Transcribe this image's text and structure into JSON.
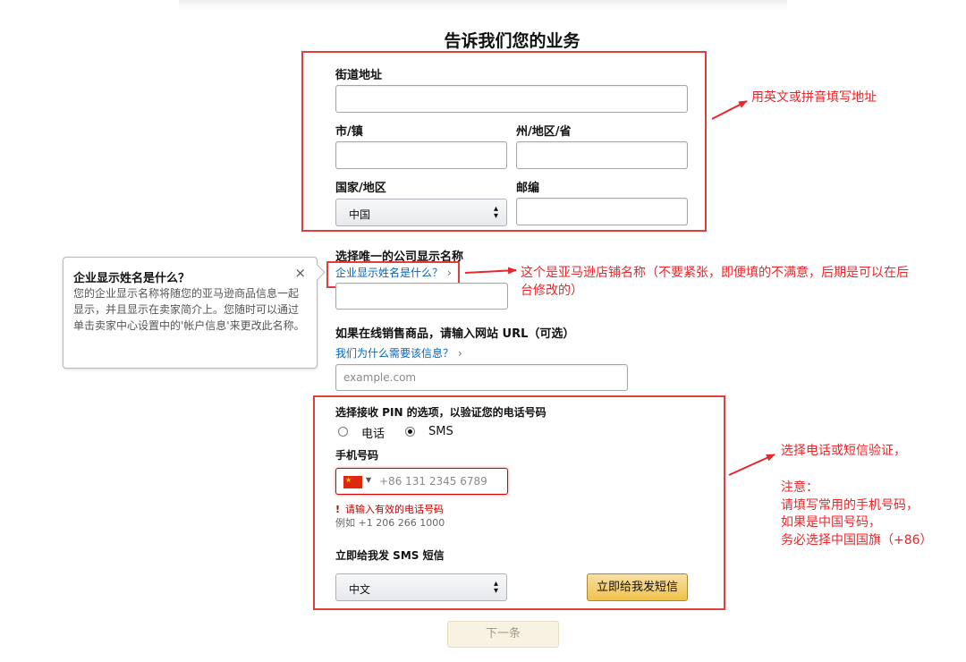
{
  "page": {
    "title": "告诉我们您的业务"
  },
  "address": {
    "street_label": "街道地址",
    "city_label": "市/镇",
    "state_label": "州/地区/省",
    "country_label": "国家/地区",
    "country_value": "中国",
    "zip_label": "邮编"
  },
  "display_name": {
    "label": "选择唯一的公司显示名称",
    "help_link": "企业显示姓名是什么？"
  },
  "popover": {
    "title": "企业显示姓名是什么？",
    "close": "×",
    "body": "您的企业显示名称将随您的亚马逊商品信息一起显示，并且显示在卖家简介上。您随时可以通过单击卖家中心设置中的'帐户信息'来更改此名称。"
  },
  "website": {
    "label": "如果在线销售商品，请输入网站 URL（可选）",
    "why_link": "我们为什么需要该信息？",
    "placeholder": "example.com"
  },
  "pin": {
    "label": "选择接收 PIN 的选项，以验证您的电话号码",
    "option_phone": "电话",
    "option_sms": "SMS",
    "selected": "SMS"
  },
  "phone": {
    "label": "手机号码",
    "placeholder": "+86 131 2345 6789",
    "error": "请输入有效的电话号码",
    "example": "例如 +1 206 266 1000"
  },
  "sms": {
    "label": "立即给我发 SMS 短信",
    "language_value": "中文",
    "send_button": "立即给我发短信"
  },
  "next_button": "下一条",
  "annotations": {
    "address_note": "用英文或拼音填写地址",
    "store_name_note_line1": "这个是亚马逊店铺名称（不要紧张，即便填的不满意，后期是可以在后",
    "store_name_note_line2": "台修改的）",
    "verify_note": "选择电话或短信验证，",
    "attention_title": "注意：",
    "attention_line1": "请填写常用的手机号码，",
    "attention_line2": "如果是中国号码，",
    "attention_line3": "务必选择中国国旗（+86）"
  },
  "colors": {
    "annotation_red": "#e8262b",
    "link_blue": "#0066c0",
    "button_gold": "#f0c14b",
    "error_red": "#c40000"
  },
  "icons": {
    "close": "close-icon",
    "chevron": "chevron-right-icon",
    "select_arrow": "up-down-arrow-icon",
    "flag": "china-flag-icon",
    "alert": "alert-icon"
  }
}
